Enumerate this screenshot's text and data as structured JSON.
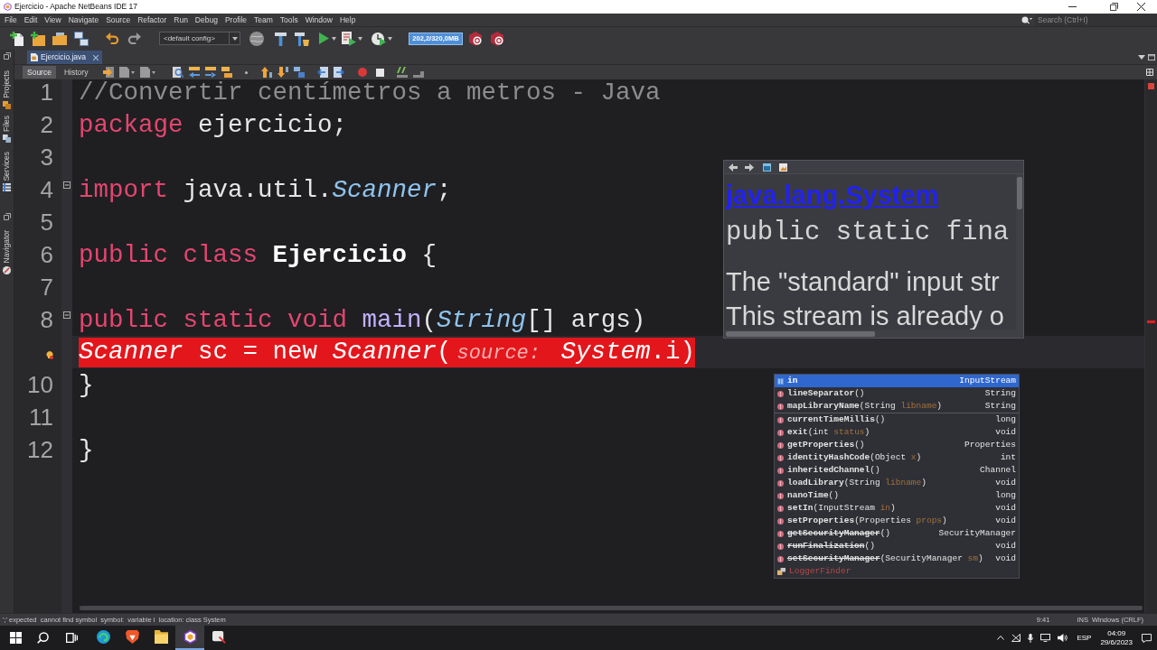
{
  "window": {
    "title": "Ejercicio - Apache NetBeans IDE 17"
  },
  "menu_bar": [
    "File",
    "Edit",
    "View",
    "Navigate",
    "Source",
    "Refactor",
    "Run",
    "Debug",
    "Profile",
    "Team",
    "Tools",
    "Window",
    "Help"
  ],
  "search": {
    "placeholder": "Search (Ctrl+I)"
  },
  "toolbar": {
    "configuration": "<default config>",
    "memory": "202,2/320,0MB"
  },
  "side_tabs": [
    {
      "label": "Projects",
      "kind": "projects"
    },
    {
      "label": "Files",
      "kind": "files"
    },
    {
      "label": "Services",
      "kind": "services"
    },
    {
      "label": "Navigator",
      "kind": "navigator"
    }
  ],
  "editor_tabs": [
    {
      "label": "Ejercicio.java",
      "selected": true
    }
  ],
  "editor_views": [
    {
      "label": "Source",
      "selected": true
    },
    {
      "label": "History",
      "selected": false
    }
  ],
  "editor": {
    "lines": [
      {
        "number": "1",
        "fold": false,
        "warning": false,
        "current": false,
        "error": false,
        "tokens": [
          {
            "text": "//Convertir centímetros a metros - Java",
            "kind": "comment"
          }
        ]
      },
      {
        "number": "2",
        "fold": false,
        "warning": false,
        "current": false,
        "error": false,
        "tokens": [
          {
            "text": "package",
            "kind": "keyword"
          },
          {
            "text": " ejercicio;",
            "kind": "plain"
          }
        ]
      },
      {
        "number": "3",
        "fold": false,
        "warning": false,
        "current": false,
        "error": false
      },
      {
        "number": "4",
        "fold": true,
        "warning": false,
        "current": false,
        "error": false,
        "tokens": [
          {
            "text": "import",
            "kind": "keyword"
          },
          {
            "text": " java.util.",
            "kind": "plain"
          },
          {
            "text": "Scanner",
            "kind": "type"
          },
          {
            "text": ";",
            "kind": "plain"
          }
        ]
      },
      {
        "number": "5",
        "fold": false,
        "warning": false,
        "current": false,
        "error": false
      },
      {
        "number": "6",
        "fold": false,
        "warning": false,
        "current": false,
        "error": false,
        "tokens": [
          {
            "text": "public class ",
            "kind": "keyword"
          },
          {
            "text": "Ejercicio",
            "kind": "declaration"
          },
          {
            "text": " {",
            "kind": "plain"
          }
        ]
      },
      {
        "number": "7",
        "fold": false,
        "warning": false,
        "current": false,
        "error": false
      },
      {
        "number": "8",
        "fold": true,
        "warning": false,
        "current": false,
        "error": false,
        "tokens": [
          {
            "text": "    public static void ",
            "kind": "keyword"
          },
          {
            "text": "main",
            "kind": "method"
          },
          {
            "text": "(",
            "kind": "plain"
          },
          {
            "text": "String",
            "kind": "type"
          },
          {
            "text": "[] ",
            "kind": "plain"
          },
          {
            "text": "args",
            "kind": "param"
          },
          {
            "text": ")",
            "kind": "plain"
          }
        ]
      },
      {
        "fold": false,
        "warning": true,
        "current": true,
        "error": true,
        "tokens": [
          {
            "text": "        Scanner",
            "kind": "type"
          },
          {
            "text": " sc = new ",
            "kind": "plain"
          },
          {
            "text": "Scanner",
            "kind": "type"
          },
          {
            "text": "(",
            "kind": "plain"
          },
          {
            "text": "source:",
            "kind": "hint"
          },
          {
            "text": " System",
            "kind": "type"
          },
          {
            "text": ".i)",
            "kind": "plain"
          }
        ]
      },
      {
        "number": "10",
        "fold": false,
        "warning": false,
        "current": false,
        "error": false,
        "tokens": [
          {
            "text": "    }",
            "kind": "plain"
          }
        ]
      },
      {
        "number": "11",
        "fold": false,
        "warning": false,
        "current": false,
        "error": false
      },
      {
        "number": "12",
        "fold": false,
        "warning": false,
        "current": false,
        "error": false,
        "tokens": [
          {
            "text": "}",
            "kind": "plain"
          }
        ]
      }
    ]
  },
  "doc_popup": {
    "link": "java.lang.System",
    "signature": "public static fina",
    "description": [
      "The \"standard\" input str",
      "This stream is already o"
    ]
  },
  "completion": {
    "sections": [
      {
        "items": [
          {
            "kind": "field",
            "selected": true,
            "deprecated": false,
            "label": [
              {
                "text": "in",
                "kind": "name"
              }
            ],
            "type": "InputStream"
          },
          {
            "kind": "method",
            "selected": false,
            "deprecated": false,
            "label": [
              {
                "text": "lineSeparator",
                "kind": "name"
              },
              {
                "text": "()",
                "kind": "plain"
              }
            ],
            "type": "String"
          },
          {
            "kind": "method",
            "selected": false,
            "deprecated": false,
            "label": [
              {
                "text": "mapLibraryName",
                "kind": "name"
              },
              {
                "text": "(String ",
                "kind": "plain"
              },
              {
                "text": "libname",
                "kind": "param"
              },
              {
                "text": ")",
                "kind": "plain"
              }
            ],
            "type": "String"
          }
        ]
      },
      {
        "items": [
          {
            "kind": "method",
            "selected": false,
            "deprecated": false,
            "label": [
              {
                "text": "currentTimeMillis",
                "kind": "name"
              },
              {
                "text": "()",
                "kind": "plain"
              }
            ],
            "type": "long"
          },
          {
            "kind": "method",
            "selected": false,
            "deprecated": false,
            "label": [
              {
                "text": "exit",
                "kind": "name"
              },
              {
                "text": "(int ",
                "kind": "plain"
              },
              {
                "text": "status",
                "kind": "param"
              },
              {
                "text": ")",
                "kind": "plain"
              }
            ],
            "type": "void"
          },
          {
            "kind": "method",
            "selected": false,
            "deprecated": false,
            "label": [
              {
                "text": "getProperties",
                "kind": "name"
              },
              {
                "text": "()",
                "kind": "plain"
              }
            ],
            "type": "Properties"
          },
          {
            "kind": "method",
            "selected": false,
            "deprecated": false,
            "label": [
              {
                "text": "identityHashCode",
                "kind": "name"
              },
              {
                "text": "(Object ",
                "kind": "plain"
              },
              {
                "text": "x",
                "kind": "param"
              },
              {
                "text": ")",
                "kind": "plain"
              }
            ],
            "type": "int"
          },
          {
            "kind": "method",
            "selected": false,
            "deprecated": false,
            "label": [
              {
                "text": "inheritedChannel",
                "kind": "name"
              },
              {
                "text": "()",
                "kind": "plain"
              }
            ],
            "type": "Channel"
          },
          {
            "kind": "method",
            "selected": false,
            "deprecated": false,
            "label": [
              {
                "text": "loadLibrary",
                "kind": "name"
              },
              {
                "text": "(String ",
                "kind": "plain"
              },
              {
                "text": "libname",
                "kind": "param"
              },
              {
                "text": ")",
                "kind": "plain"
              }
            ],
            "type": "void"
          },
          {
            "kind": "method",
            "selected": false,
            "deprecated": false,
            "label": [
              {
                "text": "nanoTime",
                "kind": "name"
              },
              {
                "text": "()",
                "kind": "plain"
              }
            ],
            "type": "long"
          },
          {
            "kind": "method",
            "selected": false,
            "deprecated": false,
            "label": [
              {
                "text": "setIn",
                "kind": "name"
              },
              {
                "text": "(InputStream ",
                "kind": "plain"
              },
              {
                "text": "in",
                "kind": "param"
              },
              {
                "text": ")",
                "kind": "plain"
              }
            ],
            "type": "void"
          },
          {
            "kind": "method",
            "selected": false,
            "deprecated": false,
            "label": [
              {
                "text": "setProperties",
                "kind": "name"
              },
              {
                "text": "(Properties ",
                "kind": "plain"
              },
              {
                "text": "props",
                "kind": "param"
              },
              {
                "text": ")",
                "kind": "plain"
              }
            ],
            "type": "void"
          },
          {
            "kind": "method",
            "selected": false,
            "deprecated": true,
            "label": [
              {
                "text": "getSecurityManager",
                "kind": "name"
              },
              {
                "text": "()",
                "kind": "plain"
              }
            ],
            "type": "SecurityManager"
          },
          {
            "kind": "method",
            "selected": false,
            "deprecated": true,
            "label": [
              {
                "text": "runFinalization",
                "kind": "name"
              },
              {
                "text": "()",
                "kind": "plain"
              }
            ],
            "type": "void"
          },
          {
            "kind": "method",
            "selected": false,
            "deprecated": true,
            "label": [
              {
                "text": "setSecurityManager",
                "kind": "name"
              },
              {
                "text": "(SecurityManager ",
                "kind": "plain"
              },
              {
                "text": "sm",
                "kind": "param"
              },
              {
                "text": ")",
                "kind": "plain"
              }
            ],
            "type": "void"
          },
          {
            "kind": "class",
            "selected": false,
            "deprecated": false,
            "label": [
              {
                "text": "LoggerFinder",
                "kind": "plain"
              }
            ]
          }
        ]
      }
    ]
  },
  "status_bar": {
    "message": "';' expected  cannot find symbol  symbol:  variable i  location: class System",
    "position": "9:41",
    "mode": "INS",
    "line_endings": "Windows (CRLF)"
  },
  "taskbar": {
    "apps": [
      {
        "kind": "edge",
        "selected": false
      },
      {
        "kind": "brave",
        "selected": false
      },
      {
        "kind": "explorer",
        "selected": false
      },
      {
        "kind": "netbeans",
        "selected": true
      },
      {
        "kind": "tool",
        "selected": false
      }
    ],
    "language": "ESP",
    "time": "04:09",
    "date": "29/6/2023"
  }
}
